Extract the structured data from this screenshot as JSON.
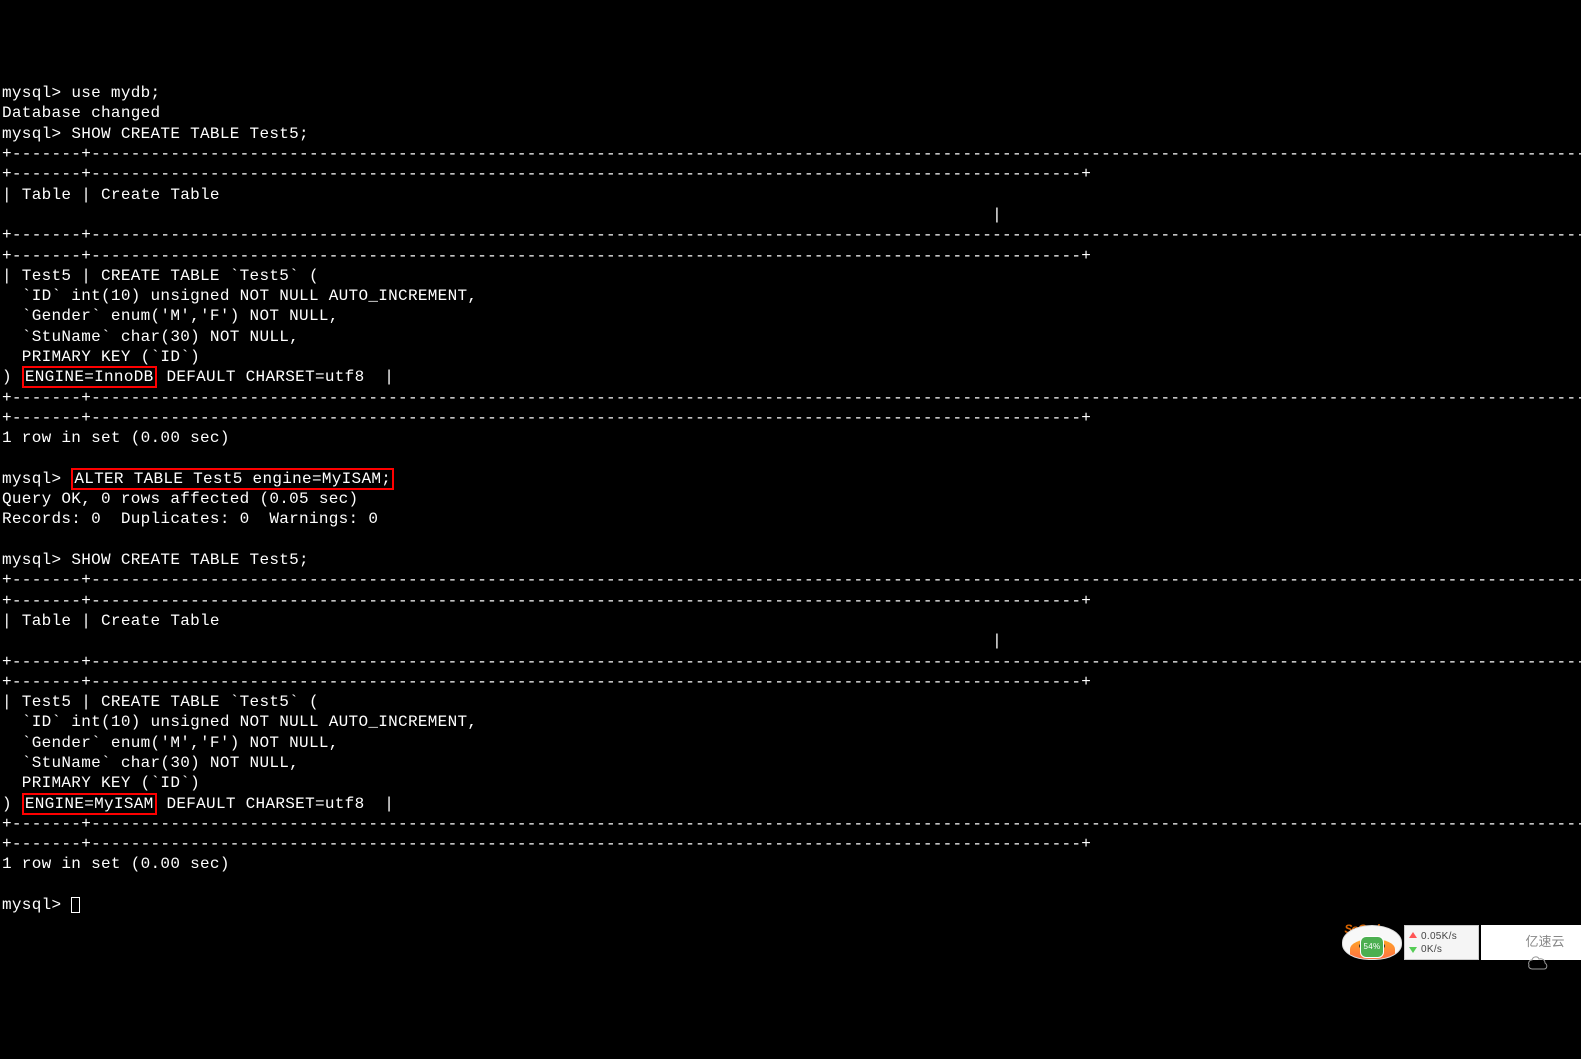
{
  "terminal": {
    "prompt": "mysql> ",
    "cmd_use": "use mydb;",
    "db_changed": "Database changed",
    "cmd_show1": "SHOW CREATE TABLE Test5;",
    "sep_long": "+-------+-----------------------------------------------------------------------------------------------------------------------------------------------------------------------------------------------------------------------------------------------------------------+",
    "sep_mid": "+-------+----------------------------------------------------------------------------------------------------+",
    "header_row": "| Table | Create Table",
    "header_pipe": "                                                                                                    |",
    "row_start1": "| Test5 | CREATE TABLE `Test5` (",
    "col_id": "  `ID` int(10) unsigned NOT NULL AUTO_INCREMENT,",
    "col_gender": "  `Gender` enum('M','F') NOT NULL,",
    "col_stuname": "  `StuName` char(30) NOT NULL,",
    "col_pk": "  PRIMARY KEY (`ID`)",
    "engine_paren": ") ",
    "engine_innodb": "ENGINE=InnoDB",
    "engine_myisam": "ENGINE=MyISAM",
    "engine_rest": " DEFAULT CHARSET=utf8  |",
    "rows_in_set": "1 row in set (0.00 sec)",
    "cmd_alter": "ALTER TABLE Test5 engine=MyISAM;",
    "query_ok": "Query OK, 0 rows affected (0.05 sec)",
    "records": "Records: 0  Duplicates: 0  Warnings: 0",
    "cmd_show2": "SHOW CREATE TABLE Test5;"
  },
  "taskbar": {
    "sogou": "SoGod",
    "huorong_pct": "54%",
    "netspeed_up": "0.05K/s",
    "netspeed_down": "0K/s",
    "watermark": "亿速云"
  }
}
